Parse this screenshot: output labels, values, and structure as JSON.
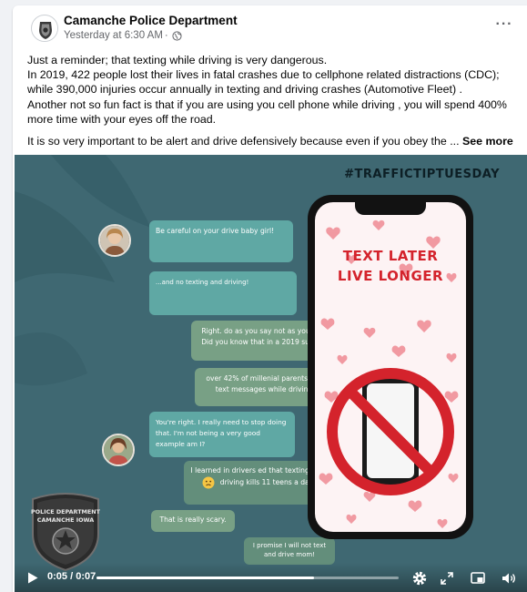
{
  "post": {
    "page_name": "Camanche Police Department",
    "timestamp": "Yesterday at 6:30 AM",
    "separator": " · ",
    "more_label": "···",
    "text_lines": [
      "Just a reminder; that texting while driving is very dangerous.",
      "In 2019, 422 people lost their lives in fatal crashes due to cellphone related distractions (CDC);",
      "while 390,000 injuries occur annually in texting and driving crashes (Automotive Fleet) .",
      "Another not so fun fact is that if you are using you cell phone while driving , you will spend 400%",
      "more time with your eyes off the road."
    ],
    "text_truncated": "It is so very important to be alert and drive defensively because even if you obey the ...",
    "see_more": "See more"
  },
  "video": {
    "hashtag": "#TRAFFICTIPTUESDAY",
    "headline_1": "TEXT LATER",
    "headline_2": "LIVE LONGER",
    "messages": {
      "m1": "Be careful on your drive baby girl!",
      "m2": "...and no texting and driving!",
      "m3": "Right. do as you say not as you do? Did you know that in a 2019 survey",
      "m4": "over 42% of millenial parents read text messages while driving?",
      "m5": "You're right. I really need to stop doing that.  I'm not being a very good example am I?",
      "m6a": "I learned in drivers ed that texting and",
      "m6b": "driving kills 11 teens a day",
      "m7": "That is really scary.",
      "m8": "I promise I will not text and drive mom!"
    },
    "badge_line_1": "POLICE DEPARTMENT",
    "badge_line_2": "CAMANCHE IOWA",
    "time_current": "0:05",
    "time_total": "0:07",
    "time_sep": " / ",
    "progress": 0.72
  },
  "colors": {
    "video_bg": "#3f6872",
    "accent_red": "#d4232c",
    "bubble_teal": "#5fa8a4",
    "bubble_green": "#78a085"
  },
  "icons": {
    "privacy": "globe-icon",
    "play": "play-icon",
    "settings": "gear-icon",
    "expand": "expand-icon",
    "pip": "picture-in-picture-icon",
    "volume": "speaker-icon"
  }
}
